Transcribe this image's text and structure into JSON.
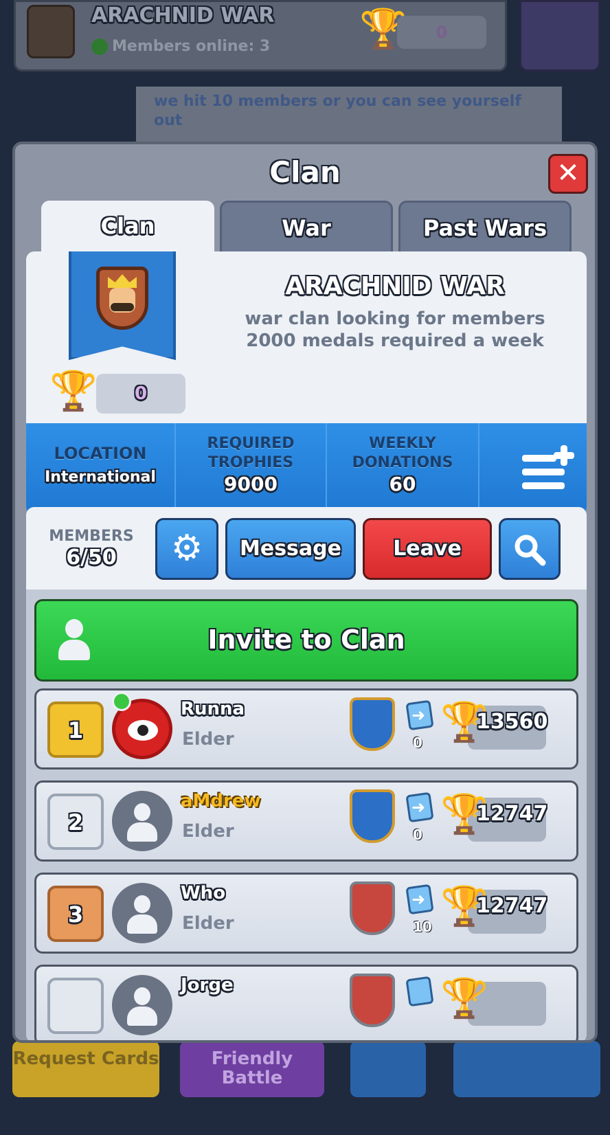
{
  "background": {
    "clan_name": "ARACHNID WAR",
    "members_online": "Members online: 3",
    "trophy_value": "0",
    "chat_text": "we hit 10 members or you can see yourself out",
    "bottom": {
      "request": "Request Cards",
      "friendly": "Friendly Battle"
    }
  },
  "modal": {
    "title": "Clan",
    "tabs": [
      "Clan",
      "War",
      "Past Wars"
    ],
    "clan": {
      "name": "ARACHNID WAR",
      "description_line1": "war clan looking for members",
      "description_line2": "2000 medals required a week",
      "trophies": "0"
    },
    "stats": {
      "location_label": "LOCATION",
      "location_value": "International",
      "required_label_1": "REQUIRED",
      "required_label_2": "TROPHIES",
      "required_value": "9000",
      "weekly_label_1": "WEEKLY",
      "weekly_label_2": "DONATIONS",
      "weekly_value": "60"
    },
    "members": {
      "label": "MEMBERS",
      "count": "6/50",
      "message_button": "Message",
      "leave_button": "Leave",
      "invite_button": "Invite to Clan"
    },
    "rows": [
      {
        "rank": "1",
        "name": "Runna",
        "role": "Elder",
        "donations": "0",
        "trophies": "13560"
      },
      {
        "rank": "2",
        "name": "aMdrew",
        "role": "Elder",
        "donations": "0",
        "trophies": "12747"
      },
      {
        "rank": "3",
        "name": "Who",
        "role": "Elder",
        "donations": "10",
        "trophies": "12747"
      },
      {
        "name": "Jorge"
      }
    ]
  },
  "colors": {
    "accent_blue": "#2f8fe6",
    "leave_red": "#e03a3a",
    "invite_green": "#2ac846",
    "gold": "#f2b92c"
  }
}
